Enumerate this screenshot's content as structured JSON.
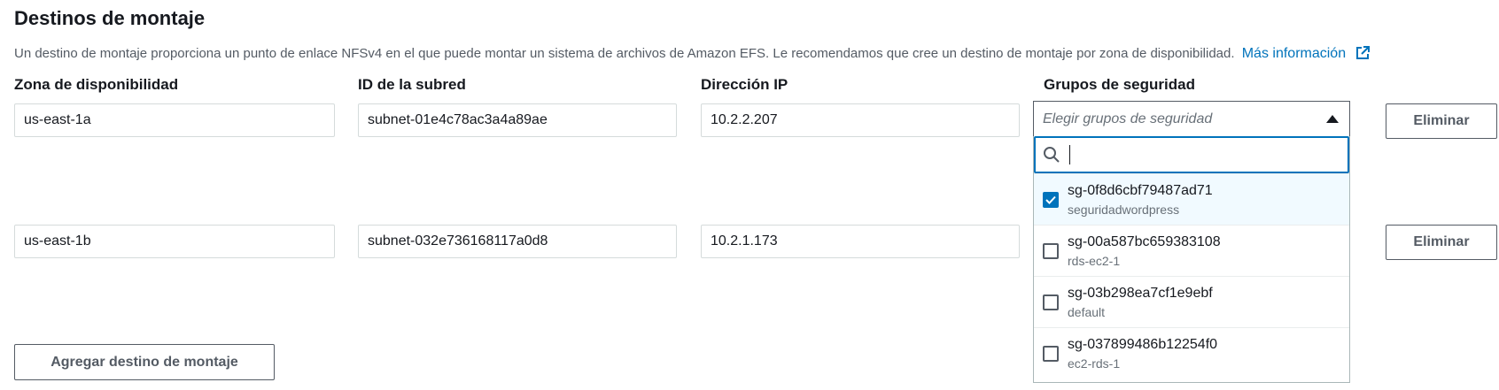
{
  "section": {
    "title": "Destinos de montaje",
    "description": "Un destino de montaje proporciona un punto de enlace NFSv4 en el que puede montar un sistema de archivos de Amazon EFS. Le recomendamos que cree un destino de montaje por zona de disponibilidad.",
    "learn_more": "Más información"
  },
  "columns": {
    "az": "Zona de disponibilidad",
    "subnet": "ID de la subred",
    "ip": "Dirección IP",
    "sg": "Grupos de seguridad"
  },
  "rows": [
    {
      "az": "us-east-1a",
      "subnet": "subnet-01e4c78ac3a4a89ae",
      "ip": "10.2.2.207",
      "remove": "Eliminar"
    },
    {
      "az": "us-east-1b",
      "subnet": "subnet-032e736168117a0d8",
      "ip": "10.2.1.173",
      "remove": "Eliminar"
    }
  ],
  "security_select": {
    "placeholder": "Elegir grupos de seguridad",
    "search_value": "",
    "options": [
      {
        "id": "sg-0f8d6cbf79487ad71",
        "name": "seguridadwordpress",
        "checked": true
      },
      {
        "id": "sg-00a587bc659383108",
        "name": "rds-ec2-1",
        "checked": false
      },
      {
        "id": "sg-03b298ea7cf1e9ebf",
        "name": "default",
        "checked": false
      },
      {
        "id": "sg-037899486b12254f0",
        "name": "ec2-rds-1",
        "checked": false
      }
    ]
  },
  "add_button": "Agregar destino de montaje",
  "colors": {
    "link": "#0073bb",
    "checkbox_on": "#0073bb",
    "selected_bg": "#f1faff"
  }
}
